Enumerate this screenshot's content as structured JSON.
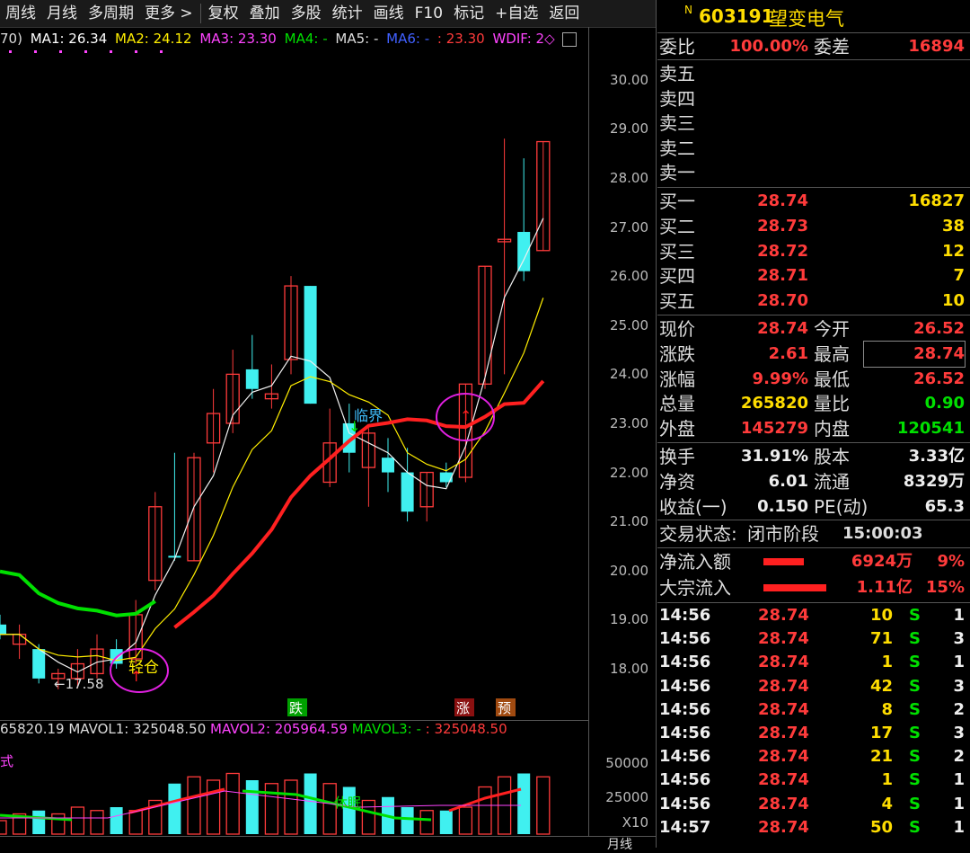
{
  "toolbar": {
    "items": [
      "周线",
      "月线",
      "多周期",
      "更多 >",
      "复权",
      "叠加",
      "多股",
      "统计",
      "画线",
      "F10",
      "标记",
      "+自选",
      "返回"
    ]
  },
  "ma": {
    "prefix": "70)",
    "ma1": "MA1: 26.34",
    "ma2": "MA2: 24.12",
    "ma3": "MA3: 23.30",
    "ma4": "MA4: -",
    "ma5": "MA5: -",
    "ma6": "MA6: -",
    "ma6b": ": 23.30",
    "wdif": "WDIF: 2◇"
  },
  "stock": {
    "badge": "N",
    "code": "603191",
    "name": "望变电气"
  },
  "weibi": {
    "label1": "委比",
    "val1": "100.00%",
    "label2": "委差",
    "val2": "16894"
  },
  "asks": [
    "卖五",
    "卖四",
    "卖三",
    "卖二",
    "卖一"
  ],
  "bids": [
    {
      "label": "买一",
      "price": "28.74",
      "vol": "16827"
    },
    {
      "label": "买二",
      "price": "28.73",
      "vol": "38"
    },
    {
      "label": "买三",
      "price": "28.72",
      "vol": "12"
    },
    {
      "label": "买四",
      "price": "28.71",
      "vol": "7"
    },
    {
      "label": "买五",
      "price": "28.70",
      "vol": "10"
    }
  ],
  "quote": [
    {
      "l1": "现价",
      "v1": "28.74",
      "c1": "red",
      "l2": "今开",
      "v2": "26.52",
      "c2": "red"
    },
    {
      "l1": "涨跌",
      "v1": "2.61",
      "c1": "red",
      "l2": "最高",
      "v2": "28.74",
      "c2": "red"
    },
    {
      "l1": "涨幅",
      "v1": "9.99%",
      "c1": "red",
      "l2": "最低",
      "v2": "26.52",
      "c2": "red"
    },
    {
      "l1": "总量",
      "v1": "265820",
      "c1": "yellow",
      "l2": "量比",
      "v2": "0.90",
      "c2": "green"
    },
    {
      "l1": "外盘",
      "v1": "145279",
      "c1": "red",
      "l2": "内盘",
      "v2": "120541",
      "c2": "green"
    }
  ],
  "stats": [
    {
      "l1": "换手",
      "v1": "31.91%",
      "l2": "股本",
      "v2": "3.33亿"
    },
    {
      "l1": "净资",
      "v1": "6.01",
      "l2": "流通",
      "v2": "8329万"
    },
    {
      "l1": "收益(一)",
      "v1": "0.150",
      "l2": "PE(动)",
      "v2": "65.3"
    }
  ],
  "status": {
    "label": "交易状态:",
    "value": "闭市阶段",
    "time": "15:00:03"
  },
  "flows": [
    {
      "label": "净流入额",
      "value": "6924万",
      "pct": "9%",
      "bar": 0.45
    },
    {
      "label": "大宗流入",
      "value": "1.11亿",
      "pct": "15%",
      "bar": 0.7
    }
  ],
  "trades": [
    {
      "t": "14:56",
      "p": "28.74",
      "v": "10",
      "s": "S",
      "n": "1"
    },
    {
      "t": "14:56",
      "p": "28.74",
      "v": "71",
      "s": "S",
      "n": "3"
    },
    {
      "t": "14:56",
      "p": "28.74",
      "v": "1",
      "s": "S",
      "n": "1"
    },
    {
      "t": "14:56",
      "p": "28.74",
      "v": "42",
      "s": "S",
      "n": "3"
    },
    {
      "t": "14:56",
      "p": "28.74",
      "v": "8",
      "s": "S",
      "n": "2"
    },
    {
      "t": "14:56",
      "p": "28.74",
      "v": "17",
      "s": "S",
      "n": "3"
    },
    {
      "t": "14:56",
      "p": "28.74",
      "v": "21",
      "s": "S",
      "n": "2"
    },
    {
      "t": "14:56",
      "p": "28.74",
      "v": "1",
      "s": "S",
      "n": "1"
    },
    {
      "t": "14:56",
      "p": "28.74",
      "v": "4",
      "s": "S",
      "n": "1"
    },
    {
      "t": "14:57",
      "p": "28.74",
      "v": "50",
      "s": "S",
      "n": "1"
    }
  ],
  "price_axis": [
    "30.00",
    "29.00",
    "28.00",
    "27.00",
    "26.00",
    "25.00",
    "24.00",
    "23.00",
    "22.00",
    "21.00",
    "20.00",
    "19.00",
    "18.00"
  ],
  "vol_axis": [
    "50000",
    "25000",
    "X10"
  ],
  "annotations": {
    "light": "轻仓",
    "low": "←17.58",
    "critical": "临界",
    "down": "跌",
    "up": "涨",
    "pre": "预",
    "rest": "休眠",
    "vol_label": "式",
    "bottom_label": "月线"
  },
  "vol_header": {
    "v0": "65820.19",
    "mavol1": "MAVOL1: 325048.50",
    "mavol2": "MAVOL2: 205964.59",
    "mavol3": "MAVOL3: -",
    "mavol3b": ": 325048.50"
  },
  "chart_data": {
    "type": "candlestick",
    "candles": [
      {
        "o": 18.9,
        "h": 19.1,
        "l": 18.6,
        "c": 18.7,
        "up": false
      },
      {
        "o": 18.5,
        "h": 18.9,
        "l": 18.2,
        "c": 18.7,
        "up": true
      },
      {
        "o": 18.4,
        "h": 18.5,
        "l": 17.7,
        "c": 17.8,
        "up": false
      },
      {
        "o": 17.8,
        "h": 18.0,
        "l": 17.58,
        "c": 17.9,
        "up": true
      },
      {
        "o": 17.8,
        "h": 18.4,
        "l": 17.6,
        "c": 18.1,
        "up": true
      },
      {
        "o": 17.9,
        "h": 18.7,
        "l": 17.8,
        "c": 18.4,
        "up": true
      },
      {
        "o": 18.4,
        "h": 18.6,
        "l": 18.0,
        "c": 18.1,
        "up": false
      },
      {
        "o": 18.2,
        "h": 19.4,
        "l": 18.1,
        "c": 19.1,
        "up": true
      },
      {
        "o": 19.8,
        "h": 21.6,
        "l": 19.6,
        "c": 21.3,
        "up": true
      },
      {
        "o": 20.3,
        "h": 22.4,
        "l": 20.2,
        "c": 20.3,
        "up": false
      },
      {
        "o": 20.2,
        "h": 22.4,
        "l": 20.2,
        "c": 22.3,
        "up": true
      },
      {
        "o": 22.6,
        "h": 23.7,
        "l": 22.0,
        "c": 23.2,
        "up": true
      },
      {
        "o": 23.0,
        "h": 24.5,
        "l": 22.8,
        "c": 24.0,
        "up": true
      },
      {
        "o": 24.1,
        "h": 24.8,
        "l": 23.5,
        "c": 23.7,
        "up": false
      },
      {
        "o": 23.5,
        "h": 24.2,
        "l": 23.3,
        "c": 23.6,
        "up": true
      },
      {
        "o": 24.3,
        "h": 26.0,
        "l": 24.0,
        "c": 25.8,
        "up": true
      },
      {
        "o": 25.8,
        "h": 25.8,
        "l": 23.4,
        "c": 23.4,
        "up": false
      },
      {
        "o": 21.8,
        "h": 23.3,
        "l": 21.7,
        "c": 22.6,
        "up": true
      },
      {
        "o": 23.0,
        "h": 23.4,
        "l": 22.0,
        "c": 22.4,
        "up": false
      },
      {
        "o": 22.1,
        "h": 22.9,
        "l": 21.3,
        "c": 22.8,
        "up": true
      },
      {
        "o": 22.3,
        "h": 22.7,
        "l": 21.6,
        "c": 22.0,
        "up": false
      },
      {
        "o": 22.0,
        "h": 22.5,
        "l": 21.0,
        "c": 21.2,
        "up": false
      },
      {
        "o": 21.3,
        "h": 22.0,
        "l": 21.0,
        "c": 22.0,
        "up": true
      },
      {
        "o": 22.0,
        "h": 22.2,
        "l": 21.7,
        "c": 21.8,
        "up": false
      },
      {
        "o": 21.9,
        "h": 23.8,
        "l": 21.8,
        "c": 23.8,
        "up": true
      },
      {
        "o": 23.8,
        "h": 26.2,
        "l": 23.7,
        "c": 26.2,
        "up": true
      },
      {
        "o": 26.75,
        "h": 28.8,
        "l": 24.0,
        "c": 26.7,
        "up": true
      },
      {
        "o": 26.9,
        "h": 28.4,
        "l": 25.9,
        "c": 26.1,
        "up": false
      },
      {
        "o": 26.52,
        "h": 28.74,
        "l": 26.52,
        "c": 28.74,
        "up": true
      }
    ],
    "volumes": [
      0.2,
      0.3,
      0.35,
      0.3,
      0.4,
      0.35,
      0.4,
      0.35,
      0.5,
      0.75,
      0.85,
      0.8,
      0.9,
      0.8,
      0.75,
      0.8,
      0.9,
      0.75,
      0.7,
      0.5,
      0.55,
      0.4,
      0.35,
      0.35,
      0.4,
      0.7,
      0.85,
      0.9,
      0.85
    ],
    "volume_up": [
      true,
      true,
      false,
      true,
      true,
      true,
      false,
      true,
      true,
      false,
      true,
      true,
      true,
      false,
      true,
      true,
      false,
      true,
      false,
      true,
      false,
      false,
      true,
      false,
      true,
      true,
      true,
      false,
      true
    ]
  }
}
